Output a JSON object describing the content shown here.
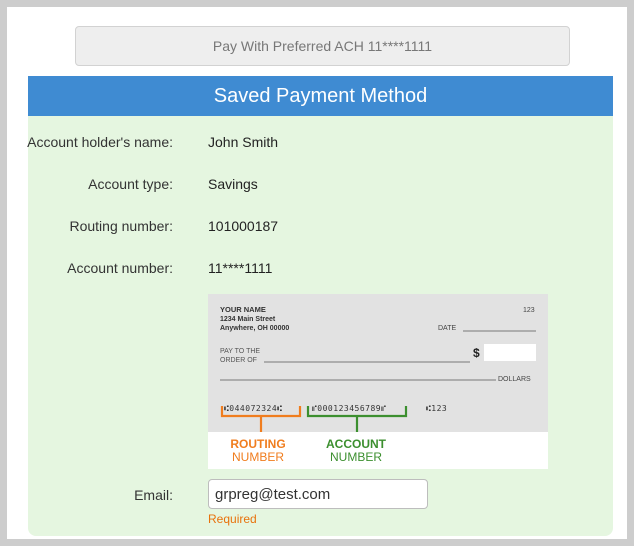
{
  "preferred_button": {
    "label": "Pay With Preferred ACH 11****1111"
  },
  "header": {
    "title": "Saved Payment Method"
  },
  "details": {
    "holder_label": "Account holder's name:",
    "holder_value": "John Smith",
    "type_label": "Account type:",
    "type_value": "Savings",
    "routing_label": "Routing number:",
    "routing_value": "101000187",
    "account_label": "Account number:",
    "account_value": "11****1111"
  },
  "check": {
    "name": "YOUR NAME",
    "street": "1234 Main Street",
    "city": "Anywhere, OH 00000",
    "number": "123",
    "date_label": "DATE",
    "pay_to_line1": "PAY TO THE",
    "pay_to_line2": "ORDER OF",
    "dollar_sign": "$",
    "dollars_label": "DOLLARS",
    "micr_routing": "⑆044072324⑆",
    "micr_account": "⑈000123456789⑈",
    "micr_check": "⑆123",
    "routing_caption_1": "ROUTING",
    "routing_caption_2": "NUMBER",
    "account_caption_1": "ACCOUNT",
    "account_caption_2": "NUMBER",
    "routing_color": "#f07d1e",
    "account_color": "#3c8f2f"
  },
  "email": {
    "label": "Email:",
    "value": "grpreg@test.com",
    "required_text": "Required"
  }
}
